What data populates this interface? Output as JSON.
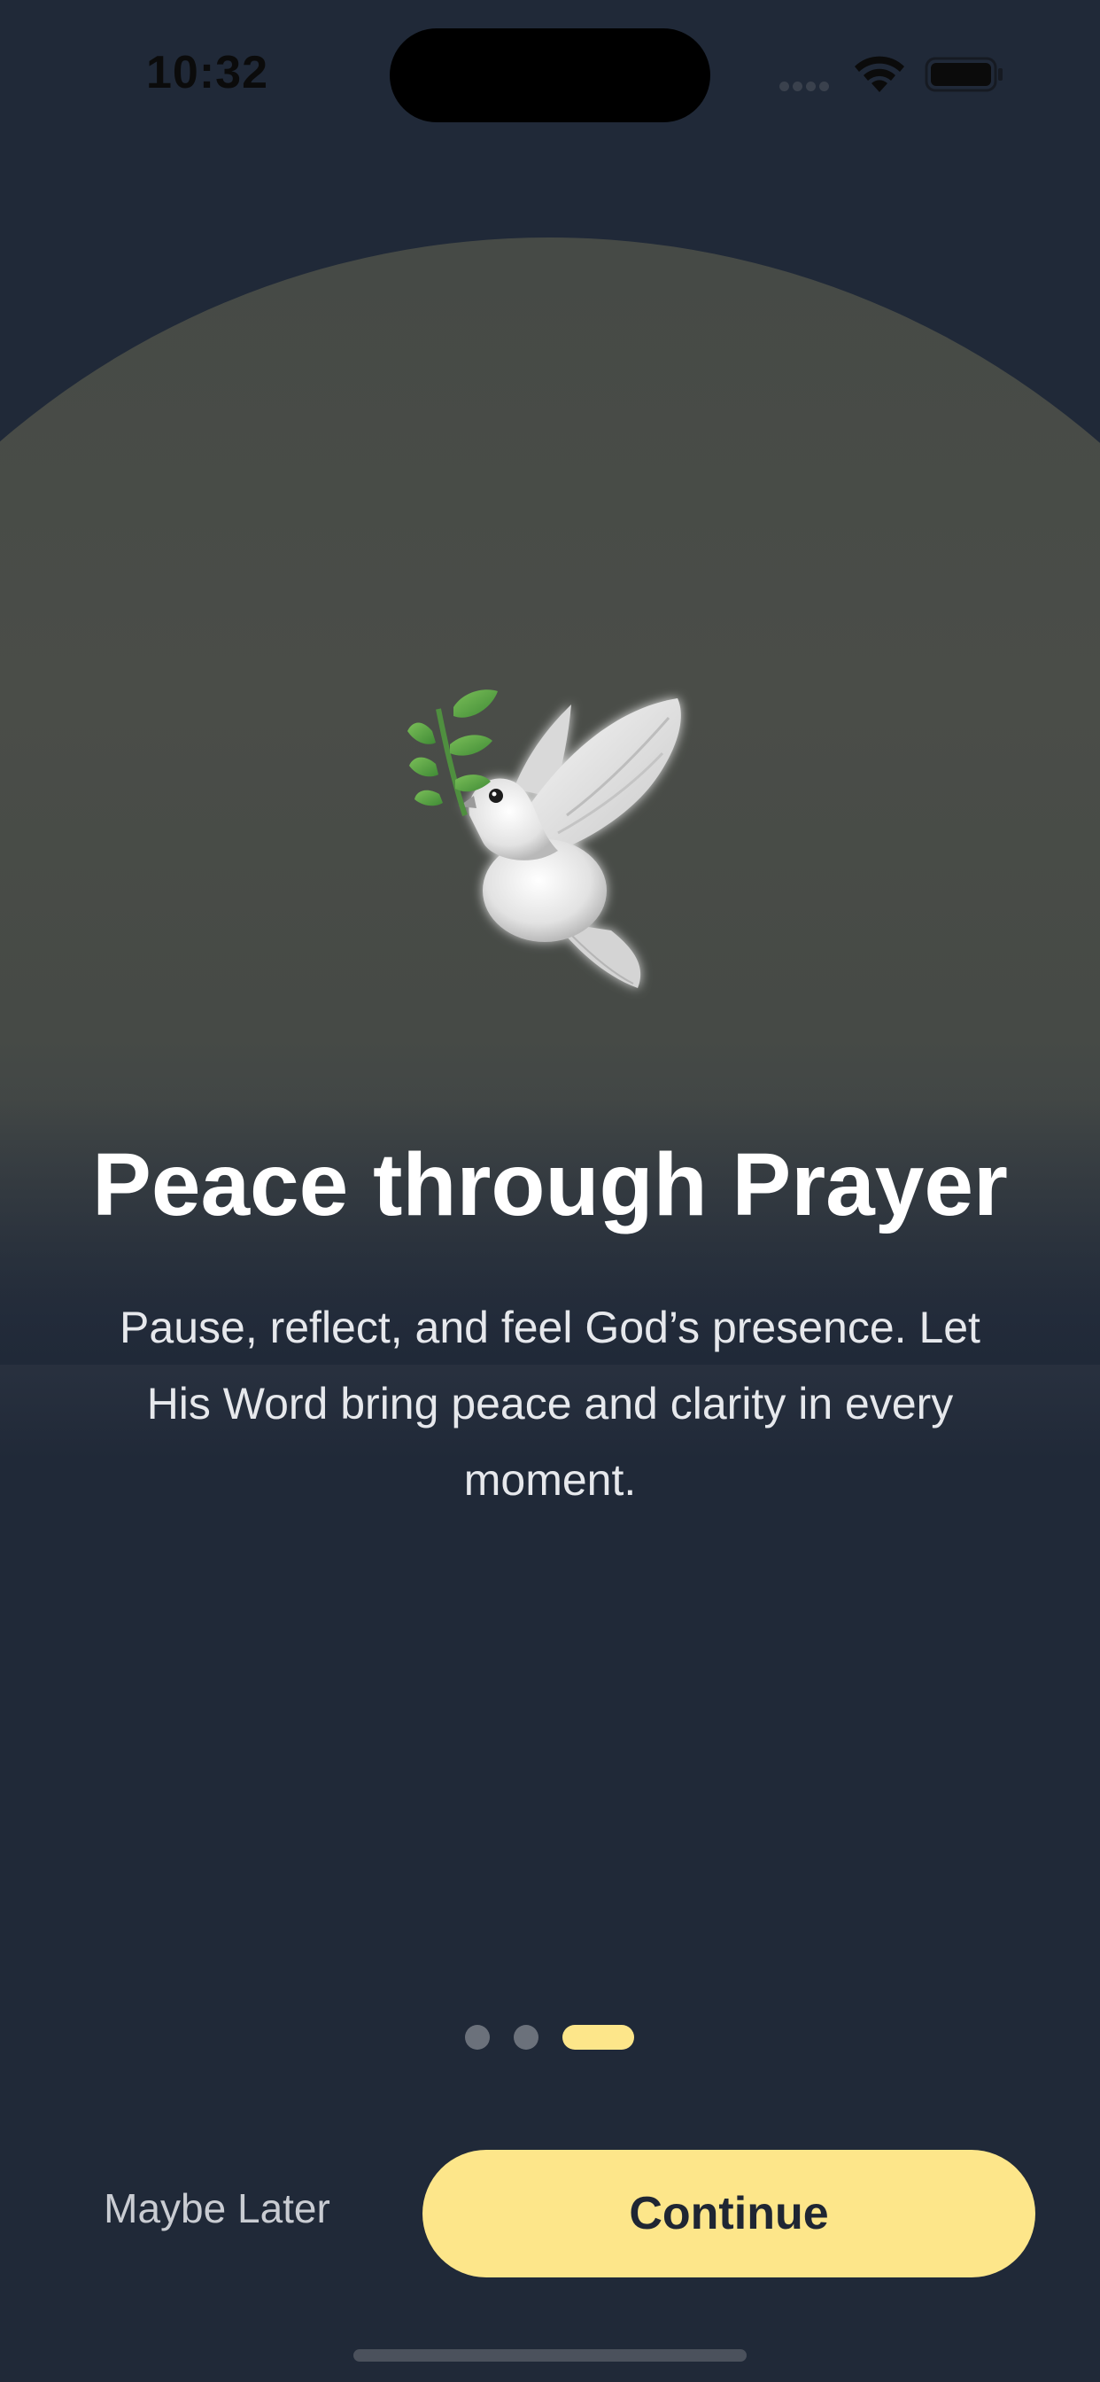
{
  "status_bar": {
    "time": "10:32",
    "icons": [
      "cellular-signal-icon",
      "wifi-icon",
      "battery-icon"
    ]
  },
  "hero": {
    "icon": "dove-icon",
    "title": "Peace through Prayer",
    "subtitle": "Pause, reflect, and feel God’s presence. Let His Word bring peace and clarity in every moment."
  },
  "page_indicator": {
    "total_pages": 3,
    "current_page": 3
  },
  "actions": {
    "secondary_label": "Maybe Later",
    "primary_label": "Continue"
  },
  "colors": {
    "background": "#202938",
    "accent": "#fde68a",
    "inactive_dot": "#6b717b",
    "title_text": "#ffffff",
    "body_text": "#e6e8ec"
  }
}
